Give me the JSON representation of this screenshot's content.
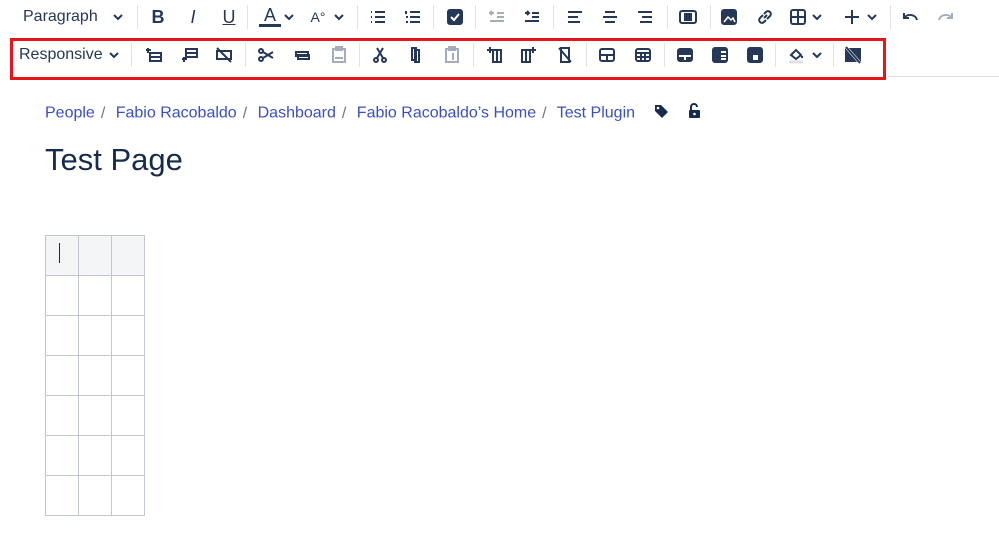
{
  "toolbar": {
    "paragraph_label": "Paragraph"
  },
  "table_toolbar": {
    "width_label": "Responsive"
  },
  "breadcrumb": [
    "People",
    "Fabio Racobaldo",
    "Dashboard",
    "Fabio Racobaldo’s Home",
    "Test Plugin"
  ],
  "breadcrumb_sep": "/",
  "page": {
    "title": "Test Page"
  },
  "table": {
    "rows": 7,
    "cols": 3
  },
  "colors": {
    "highlight": "#e8141b",
    "link": "#3b4fc4",
    "text": "#172b4d"
  }
}
